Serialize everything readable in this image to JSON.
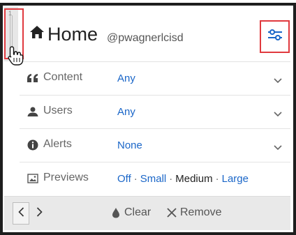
{
  "header": {
    "title": "Home",
    "username": "@pwagnerlcisd"
  },
  "drag_handle": {
    "column_number": "1"
  },
  "filters": {
    "content": {
      "label": "Content",
      "value": "Any"
    },
    "users": {
      "label": "Users",
      "value": "Any"
    },
    "alerts": {
      "label": "Alerts",
      "value": "None"
    },
    "previews": {
      "label": "Previews",
      "options": [
        "Off",
        "Small",
        "Medium",
        "Large"
      ],
      "separator": "·",
      "selected": "Medium"
    }
  },
  "bottom_bar": {
    "clear_label": "Clear",
    "remove_label": "Remove"
  },
  "colors": {
    "link": "#1a66c8",
    "highlight": "#e0393e",
    "border": "#1e1e1e"
  }
}
